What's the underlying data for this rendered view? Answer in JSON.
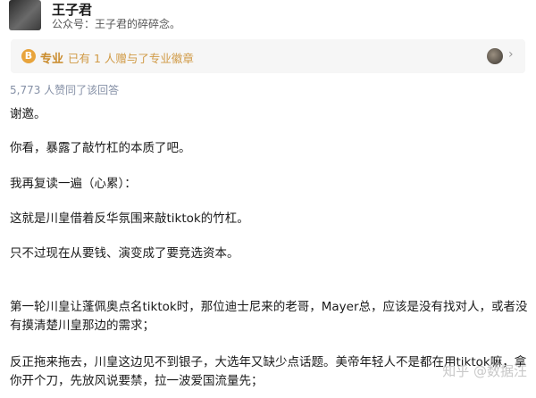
{
  "author": {
    "name": "王子君",
    "bio": "公众号：王子君的碎碎念。"
  },
  "badge": {
    "icon_symbol": "B",
    "label": "专业",
    "text": "已有 1 人赠与了专业徽章"
  },
  "votes": "5,773 人赞同了该回答",
  "answer": {
    "p1": "谢邀。",
    "p2": "你看，暴露了敲竹杠的本质了吧。",
    "p3": "我再复读一遍（心累）：",
    "p4": "这就是川皇借着反华氛围来敲tiktok的竹杠。",
    "p5": "只不过现在从要钱、演变成了要竞选资本。",
    "p6_line1": "第一轮川皇让蓬佩奥点名tiktok时，那位迪士尼来的老哥，Mayer总，应该是没有找对人，或者没",
    "p6_line2": "有摸清楚川皇那边的需求；",
    "p7_line1": "反正拖来拖去，川皇这边见不到银子，大选年又缺少点话题。美帝年轻人不是都在用tiktok嘛，拿",
    "p7_line2": "你开个刀，先放风说要禁，拉一波爱国流量先；"
  },
  "watermark": "知乎 @数据汪"
}
